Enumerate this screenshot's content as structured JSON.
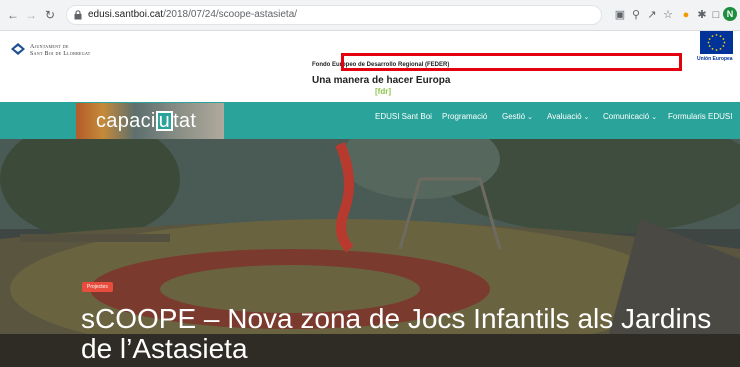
{
  "browser": {
    "url_host": "edusi.santboi.cat",
    "url_path": "/2018/07/24/scoope-astasieta/",
    "back_icon": "arrow-left",
    "forward_icon": "arrow-right",
    "reload_icon": "reload",
    "profile_initial": "N"
  },
  "header": {
    "ajuntament_line1": "Ajuntament de",
    "ajuntament_line2": "Sant Boi de Llobregat",
    "feder_line": "Fondo Europeo de Desarrollo Regional (FEDER)",
    "feder_slogan": "Una manera de hacer Europa",
    "feder_mark": "[fdr]",
    "eu_label": "Unión Europea"
  },
  "nav": {
    "logo_pre": "capaci",
    "logo_u": "u",
    "logo_post": "tat",
    "items": [
      {
        "label": "EDUSI Sant Boi",
        "dropdown": false
      },
      {
        "label": "Programació",
        "dropdown": false
      },
      {
        "label": "Gestió",
        "dropdown": true
      },
      {
        "label": "Avaluació",
        "dropdown": true
      },
      {
        "label": "Comunicació",
        "dropdown": true
      },
      {
        "label": "Formularis EDUSI",
        "dropdown": false
      }
    ]
  },
  "hero": {
    "badge": "Projectes",
    "title": "sCOOPE – Nova zona de Jocs Infantils als Jardins de l’Astasieta"
  }
}
